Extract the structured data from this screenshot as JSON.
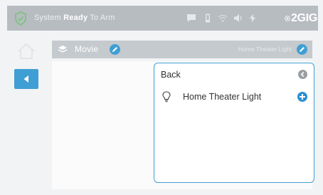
{
  "status_bar": {
    "prefix": "System ",
    "state": "Ready",
    "suffix": " To Arm",
    "icons": [
      "chat-icon",
      "phone-icon",
      "wifi-icon",
      "volume-icon",
      "bolt-icon"
    ],
    "logo_text": "2GIG",
    "shield_color": "#7cc37e"
  },
  "scene": {
    "name": "Movie",
    "right_text": "Home Theater Light"
  },
  "popup": {
    "back_label": "Back",
    "device_label": "Home Theater Light"
  },
  "colors": {
    "accent": "#3f9fd4",
    "status_bar": "#b7bcc1"
  }
}
